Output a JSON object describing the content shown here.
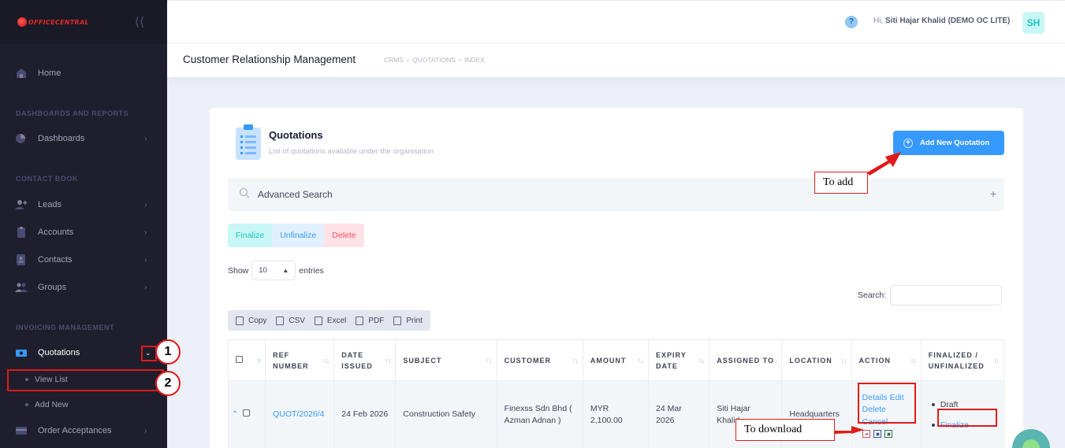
{
  "app": {
    "logo_text": "OFFICECENTRAL"
  },
  "sidebar": {
    "home_label": "Home",
    "section_dashboards": "DASHBOARDS AND REPORTS",
    "dashboards_label": "Dashboards",
    "section_contact": "CONTACT BOOK",
    "leads_label": "Leads",
    "accounts_label": "Accounts",
    "contacts_label": "Contacts",
    "groups_label": "Groups",
    "section_invoicing": "INVOICING MANAGEMENT",
    "quotations_label": "Quotations",
    "view_list_label": "View List",
    "add_new_label": "Add New",
    "order_acceptances_label": "Order Acceptances"
  },
  "header": {
    "greeting_prefix": "Hi,",
    "user_name": "Siti Hajar Khalid (DEMO OC LITE)",
    "avatar_initials": "SH",
    "help_icon": "?"
  },
  "subheader": {
    "title": "Customer Relationship Management",
    "breadcrumb": [
      "CRMS",
      "QUOTATIONS",
      "INDEX"
    ]
  },
  "card": {
    "title": "Quotations",
    "subtitle": "List of quotations available under the organisation",
    "add_button": "Add New Quotation",
    "advanced_search": "Advanced Search",
    "bulk": {
      "finalize": "Finalize",
      "unfinalize": "Unfinalize",
      "delete": "Delete"
    },
    "show_prefix": "Show",
    "page_length": "10",
    "show_suffix": "entries",
    "search_label": "Search:",
    "export_buttons": {
      "copy": "Copy",
      "csv": "CSV",
      "excel": "Excel",
      "pdf": "PDF",
      "print": "Print"
    }
  },
  "table": {
    "headers": {
      "ref_number": "REF NUMBER",
      "date_issued": "DATE ISSUED",
      "subject": "SUBJECT",
      "customer": "CUSTOMER",
      "amount": "AMOUNT",
      "expiry_date": "EXPIRY DATE",
      "assigned_to": "ASSIGNED TO",
      "location": "LOCATION",
      "action": "ACTION",
      "finalized": "FINALIZED / UNFINALIZED"
    },
    "rows": [
      {
        "ref": "QUOT/2026/4",
        "date_issued": "24 Feb 2026",
        "subject": "Construction Safety",
        "customer": "Finexss Sdn Bhd ( Azman Adnan )",
        "amount": "MYR 2,100.00",
        "expiry": "24 Mar 2026",
        "assigned": "Siti Hajar Khalid",
        "location": "Headquarters",
        "actions": {
          "details": "Details",
          "edit": "Edit",
          "delete": "Delete",
          "cancel": "Cancel"
        },
        "status": "Draft",
        "finalize_link": "Finalize"
      }
    ]
  },
  "annotations": {
    "to_add": "To add",
    "to_download": "To download",
    "step1": "1",
    "step2": "2"
  },
  "colors": {
    "sidebar_bg": "#1e1e2d",
    "primary": "#3699ff",
    "success": "#1bc5bd",
    "danger": "#f64e60",
    "annotation_red": "#e01b1b"
  }
}
